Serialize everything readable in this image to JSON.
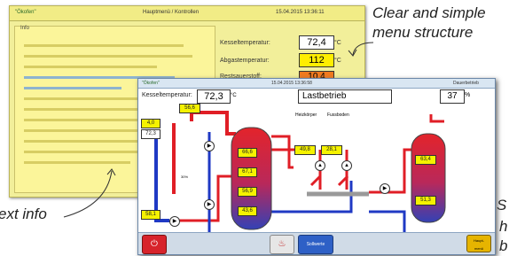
{
  "back": {
    "logo": "\"Ökofen\"",
    "title": "Hauptmenü / Kontrollen",
    "datetime": "15.04.2015 13:36:11",
    "box_label": "Info",
    "rows": [
      {
        "label": "Kesseltemperatur:",
        "value": "72,4",
        "unit": "°C",
        "bg": "#ffffff"
      },
      {
        "label": "Abgastemperatur:",
        "value": "112",
        "unit": "°C",
        "bg": "#ffee00"
      },
      {
        "label": "Restsauerstoff:",
        "value": "10,4",
        "unit": "",
        "bg": "#f07a1e"
      }
    ]
  },
  "front": {
    "logo": "\"Ökofen\"",
    "datetime": "15.04.2015 13:36:58",
    "mode_label": "Dauerbetrieb",
    "kessel_label": "Kesseltemperatur:",
    "kessel_value": "72,3",
    "kessel_unit": "°C",
    "status": "Lastbetrieb",
    "power_value": "37",
    "power_unit": "%",
    "heat_labels": [
      "Heizkörper",
      "Fussboden"
    ],
    "tags": {
      "t1": "56,6",
      "t2": "4,0",
      "t3": "72,3",
      "s1": "66,6",
      "s2": "67,1",
      "s3": "56,9",
      "s4": "43,6",
      "h1": "49,8",
      "h2": "28,1",
      "w1": "63,4",
      "w2": "51,3",
      "b1": "58,1"
    },
    "pct_label": "30%",
    "buttons": {
      "mid": "Sollwerte",
      "right": "Haupt-\nmenü"
    }
  },
  "captions": {
    "top_right": "Clear and simple\nmenu structure",
    "left": "ext info",
    "right1": "S",
    "right2": "h",
    "right3": "b"
  },
  "colors": {
    "tank_red": "#d9262c",
    "tank_blue": "#2b3cb8",
    "pipe_red": "#e01e26",
    "pipe_blue": "#1f39c4",
    "tag_yellow": "#f5f200"
  }
}
